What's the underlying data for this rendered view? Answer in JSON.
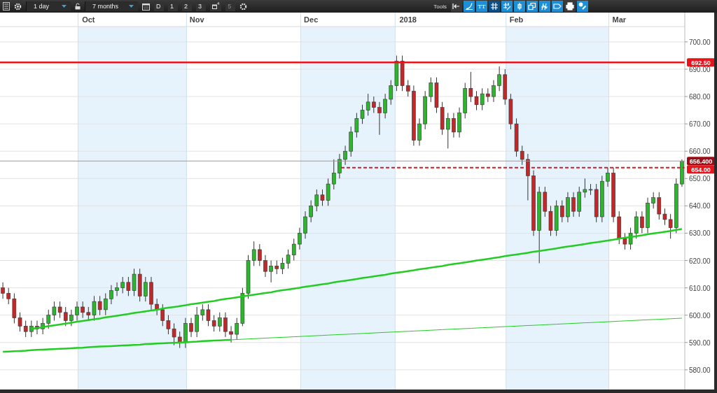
{
  "toolbar": {
    "interval": "1 day",
    "range": "7 months",
    "period_buttons": [
      {
        "label": "D",
        "kind": "text",
        "disabled": false
      },
      {
        "label": "1",
        "kind": "text",
        "disabled": false
      },
      {
        "label": "2",
        "kind": "text",
        "disabled": false
      },
      {
        "label": "3",
        "kind": "text",
        "disabled": false
      },
      {
        "label": "4",
        "kind": "icon",
        "disabled": false
      },
      {
        "label": "5",
        "kind": "text",
        "disabled": true
      }
    ],
    "tools_label": "Tools",
    "tools": [
      {
        "selected": false
      },
      {
        "selected": false
      },
      {
        "selected": false,
        "label": "TT"
      },
      {
        "selected": true
      },
      {
        "selected": false
      },
      {
        "selected": false
      },
      {
        "selected": false
      },
      {
        "selected": false
      },
      {
        "selected": false
      },
      {
        "selected": false
      },
      {
        "selected": false
      }
    ]
  },
  "chart": {
    "chart_data": {
      "type": "candlestick",
      "grid": true,
      "ylim": [
        572.8,
        705.6
      ],
      "categories": [
        null,
        null,
        null,
        null,
        null,
        null,
        null,
        null,
        null,
        null,
        null,
        null,
        null,
        null,
        null,
        "Oct",
        null,
        null,
        null,
        null,
        null,
        null,
        null,
        null,
        null,
        null,
        null,
        null,
        null,
        null,
        null,
        null,
        null,
        null,
        "Nov",
        null,
        null,
        null,
        null,
        null,
        null,
        null,
        null,
        null,
        null,
        null,
        null,
        null,
        null,
        null,
        null,
        null,
        null,
        null,
        "Dec",
        null,
        null,
        null,
        null,
        null,
        null,
        null,
        null,
        null,
        null,
        null,
        null,
        null,
        null,
        null,
        null,
        "2018",
        null,
        null,
        null,
        null,
        null,
        null,
        null,
        null,
        null,
        null,
        null,
        null,
        null,
        null,
        null,
        null,
        null,
        null,
        "Feb",
        null,
        null,
        null,
        null,
        null,
        null,
        null,
        null,
        null,
        null,
        null,
        null,
        null,
        null,
        null,
        null,
        null,
        "Mar",
        null,
        null,
        null,
        null,
        null,
        null,
        null,
        null,
        null,
        null,
        null
      ],
      "series": [
        {
          "type": "line",
          "color": "#22cc22",
          "values": [
            null,
            null,
            null,
            null,
            null,
            595.0,
            595.3,
            595.6,
            596.0,
            596.3,
            596.6,
            596.9,
            597.2,
            597.6,
            597.9,
            598.2,
            598.5,
            598.8,
            599.2,
            599.5,
            599.8,
            600.1,
            600.4,
            600.8,
            601.1,
            601.4,
            601.7,
            602.0,
            602.4,
            602.7,
            603.0,
            603.3,
            603.6,
            604.0,
            604.3,
            604.6,
            604.9,
            605.2,
            605.6,
            605.9,
            606.2,
            606.5,
            606.8,
            607.2,
            607.5,
            607.8,
            608.1,
            608.4,
            608.8,
            609.1,
            609.4,
            609.7,
            610.0,
            610.4,
            610.7,
            611.0,
            611.3,
            611.6,
            612.0,
            612.3,
            612.6,
            612.9,
            613.2,
            613.6,
            613.9,
            614.2,
            614.5,
            614.8,
            615.2,
            615.5,
            615.8,
            616.1,
            616.4,
            616.8,
            617.1,
            617.4,
            617.7,
            618.0,
            618.4,
            618.7,
            619.0,
            619.3,
            619.6,
            620.0,
            620.3,
            620.6,
            620.9,
            621.2,
            621.6,
            621.9,
            622.2,
            622.5,
            622.8,
            623.2,
            623.5,
            623.8,
            624.1,
            624.4,
            624.8,
            625.1,
            625.4,
            625.7,
            626.0,
            626.4,
            626.7,
            627.0,
            627.3,
            627.6,
            628.0,
            628.3,
            628.6,
            628.9,
            629.2,
            629.6,
            629.9,
            630.2,
            630.5,
            630.8,
            631.2,
            631.5
          ]
        },
        {
          "type": "line",
          "color": "#22cc22",
          "values": [
            586.6,
            586.7,
            586.8,
            586.9,
            587.0,
            587.2,
            587.3,
            587.4,
            587.5,
            587.6,
            587.7,
            587.8,
            587.9,
            588.0,
            588.1,
            588.3,
            588.4,
            588.5,
            588.6,
            588.7,
            588.8,
            588.9,
            589.0,
            589.1,
            589.2,
            589.4,
            589.5,
            589.6,
            589.7,
            589.8,
            589.9,
            590.0,
            590.1,
            590.2,
            590.3,
            590.5,
            590.6,
            590.7,
            590.8,
            590.9,
            591.0,
            null,
            null,
            null,
            null,
            null,
            null,
            null,
            null,
            null,
            null,
            null,
            null,
            null,
            null,
            null,
            null,
            null,
            null,
            null,
            null,
            null,
            null,
            null,
            null,
            null,
            null,
            null,
            null,
            null,
            null,
            null,
            null,
            null,
            null,
            null,
            null,
            null,
            null,
            null,
            null,
            null,
            null,
            null,
            null,
            null,
            null,
            null,
            null,
            null,
            null,
            null,
            null,
            null,
            null,
            null,
            null,
            null,
            null,
            null,
            null,
            null,
            null,
            null,
            null,
            null,
            null,
            null,
            null,
            null,
            null,
            null,
            null,
            null,
            null,
            null,
            null,
            null,
            null,
            null
          ]
        },
        {
          "type": "line",
          "color": "#22cc22",
          "values": [
            null,
            null,
            null,
            null,
            null,
            null,
            null,
            null,
            null,
            null,
            null,
            null,
            null,
            null,
            null,
            null,
            null,
            null,
            null,
            null,
            null,
            null,
            null,
            null,
            null,
            null,
            null,
            null,
            null,
            null,
            null,
            null,
            null,
            null,
            null,
            null,
            null,
            null,
            null,
            null,
            591.0,
            591.1,
            591.2,
            591.3,
            591.4,
            591.5,
            591.6,
            591.7,
            591.8,
            591.9,
            592.0,
            592.1,
            592.2,
            592.3,
            592.4,
            592.5,
            592.6,
            592.7,
            592.8,
            592.9,
            593.0,
            593.1,
            593.2,
            593.3,
            593.4,
            593.5,
            593.6,
            593.7,
            593.8,
            593.9,
            594.0,
            594.1,
            594.2,
            594.3,
            594.4,
            594.5,
            594.6,
            594.7,
            594.8,
            594.9,
            595.0,
            595.1,
            595.2,
            595.3,
            595.4,
            595.5,
            595.6,
            595.7,
            595.8,
            595.9,
            596.0,
            596.1,
            596.2,
            596.3,
            596.4,
            596.5,
            596.6,
            596.7,
            596.8,
            596.9,
            597.0,
            597.1,
            597.2,
            597.3,
            597.4,
            597.5,
            597.6,
            597.7,
            597.8,
            597.9,
            598.0,
            598.1,
            598.2,
            598.3,
            598.4,
            598.5,
            598.6,
            598.7,
            598.8,
            598.9
          ]
        }
      ],
      "yticks": [
        {
          "value": 580,
          "label": "580.00"
        },
        {
          "value": 590,
          "label": "590.00"
        },
        {
          "value": 600,
          "label": "600.00"
        },
        {
          "value": 610,
          "label": "610.00"
        },
        {
          "value": 620,
          "label": "620.00"
        },
        {
          "value": 630,
          "label": "630.00"
        },
        {
          "value": 640,
          "label": "640.00"
        },
        {
          "value": 650,
          "label": "650.00"
        },
        {
          "value": 660,
          "label": "660.00"
        },
        {
          "value": 670,
          "label": "670.00"
        },
        {
          "value": 680,
          "label": "680.00"
        },
        {
          "value": 690,
          "label": "690.00"
        },
        {
          "value": 700,
          "label": "700.00"
        }
      ],
      "ohlc": [
        [
          610,
          612,
          606,
          608
        ],
        [
          608,
          610,
          604,
          606
        ],
        [
          606,
          608,
          597,
          599
        ],
        [
          599,
          601,
          594,
          596
        ],
        [
          596,
          598,
          592,
          594
        ],
        [
          594,
          598,
          592,
          596
        ],
        [
          596,
          598,
          593,
          595
        ],
        [
          595,
          599,
          593,
          597
        ],
        [
          597,
          602,
          595,
          600
        ],
        [
          600,
          605,
          598,
          603
        ],
        [
          603,
          605,
          599,
          601
        ],
        [
          601,
          603,
          596,
          598
        ],
        [
          598,
          602,
          596,
          600
        ],
        [
          600,
          605,
          598,
          603
        ],
        [
          603,
          605,
          599,
          601
        ],
        [
          601,
          603,
          598,
          600
        ],
        [
          600,
          607,
          598,
          605
        ],
        [
          605,
          607,
          600,
          602
        ],
        [
          602,
          608,
          600,
          606
        ],
        [
          606,
          611,
          604,
          609
        ],
        [
          609,
          612,
          607,
          610
        ],
        [
          610,
          614,
          608,
          612
        ],
        [
          612,
          614,
          607,
          609
        ],
        [
          609,
          617,
          607,
          615
        ],
        [
          615,
          617,
          605,
          607
        ],
        [
          607,
          614,
          605,
          612
        ],
        [
          612,
          614,
          602,
          604
        ],
        [
          604,
          606,
          600,
          602
        ],
        [
          602,
          604,
          596,
          598
        ],
        [
          598,
          600,
          593,
          595
        ],
        [
          595,
          597,
          589,
          592
        ],
        [
          592,
          594,
          588,
          590
        ],
        [
          590,
          599,
          588,
          597
        ],
        [
          597,
          599,
          592,
          594
        ],
        [
          594,
          603,
          592,
          600
        ],
        [
          600,
          604,
          598,
          602
        ],
        [
          602,
          604,
          596,
          598
        ],
        [
          598,
          600,
          594,
          596
        ],
        [
          596,
          601,
          594,
          599
        ],
        [
          599,
          601,
          592,
          594
        ],
        [
          594,
          596,
          590,
          593
        ],
        [
          593,
          599,
          591,
          597
        ],
        [
          597,
          610,
          596,
          608
        ],
        [
          608,
          622,
          606,
          620
        ],
        [
          620,
          627,
          618,
          624
        ],
        [
          624,
          626,
          618,
          620
        ],
        [
          620,
          622,
          614,
          616
        ],
        [
          616,
          620,
          612,
          618
        ],
        [
          618,
          620,
          615,
          617
        ],
        [
          617,
          621,
          615,
          619
        ],
        [
          619,
          624,
          617,
          622
        ],
        [
          622,
          628,
          620,
          626
        ],
        [
          626,
          632,
          624,
          630
        ],
        [
          630,
          638,
          628,
          636
        ],
        [
          636,
          642,
          634,
          640
        ],
        [
          640,
          646,
          638,
          644
        ],
        [
          644,
          646,
          640,
          642
        ],
        [
          642,
          650,
          640,
          648
        ],
        [
          648,
          657,
          646,
          652
        ],
        [
          652,
          659,
          650,
          657
        ],
        [
          657,
          662,
          655,
          660
        ],
        [
          660,
          669,
          658,
          667
        ],
        [
          667,
          674,
          665,
          672
        ],
        [
          672,
          677,
          670,
          675
        ],
        [
          675,
          681,
          673,
          678
        ],
        [
          678,
          680,
          674,
          676
        ],
        [
          676,
          678,
          666,
          674
        ],
        [
          674,
          681,
          672,
          679
        ],
        [
          679,
          686,
          677,
          684
        ],
        [
          684,
          695,
          682,
          693
        ],
        [
          693,
          695,
          682,
          684
        ],
        [
          684,
          686,
          680,
          682
        ],
        [
          682,
          684,
          662,
          664
        ],
        [
          664,
          672,
          662,
          670
        ],
        [
          670,
          682,
          668,
          680
        ],
        [
          680,
          687,
          678,
          685
        ],
        [
          685,
          687,
          674,
          676
        ],
        [
          676,
          678,
          666,
          668
        ],
        [
          668,
          674,
          661,
          672
        ],
        [
          672,
          674,
          665,
          667
        ],
        [
          667,
          676,
          665,
          674
        ],
        [
          674,
          685,
          672,
          683
        ],
        [
          683,
          689,
          678,
          680
        ],
        [
          680,
          682,
          675,
          677
        ],
        [
          677,
          683,
          675,
          681
        ],
        [
          681,
          683,
          678,
          680
        ],
        [
          680,
          686,
          678,
          684
        ],
        [
          684,
          691,
          682,
          688
        ],
        [
          688,
          690,
          677,
          679
        ],
        [
          679,
          681,
          668,
          670
        ],
        [
          670,
          672,
          658,
          660
        ],
        [
          660,
          662,
          655,
          657
        ],
        [
          657,
          659,
          642,
          651
        ],
        [
          651,
          653,
          629,
          631
        ],
        [
          631,
          647,
          619,
          645
        ],
        [
          645,
          647,
          636,
          638
        ],
        [
          638,
          640,
          629,
          631
        ],
        [
          631,
          642,
          629,
          640
        ],
        [
          640,
          642,
          634,
          636
        ],
        [
          636,
          645,
          634,
          643
        ],
        [
          643,
          645,
          636,
          638
        ],
        [
          638,
          647,
          636,
          645
        ],
        [
          645,
          650,
          643,
          646
        ],
        [
          646,
          648,
          644,
          646
        ],
        [
          646,
          648,
          634,
          636
        ],
        [
          636,
          651,
          634,
          649
        ],
        [
          649,
          654,
          647,
          652
        ],
        [
          652,
          654,
          634,
          636
        ],
        [
          636,
          638,
          626,
          628
        ],
        [
          628,
          630,
          624,
          626
        ],
        [
          626,
          632,
          624,
          630
        ],
        [
          630,
          638,
          628,
          636
        ],
        [
          636,
          638,
          630,
          632
        ],
        [
          632,
          643,
          630,
          641
        ],
        [
          641,
          645,
          639,
          643
        ],
        [
          643,
          645,
          635,
          637
        ],
        [
          637,
          639,
          633,
          635
        ],
        [
          635,
          637,
          628,
          632
        ],
        [
          632,
          650,
          630,
          648
        ],
        [
          648,
          657,
          647,
          656.4
        ]
      ],
      "ref_lines": [
        {
          "axis": "y",
          "value": 692.5,
          "label": "692.50",
          "color": "#e8141c"
        },
        {
          "axis": "y",
          "value": 656.4,
          "label": "656.400",
          "color": "#9a9a9a"
        },
        {
          "axis": "y",
          "value": 654,
          "label": "654.00",
          "color": "#e8141c"
        }
      ]
    }
  }
}
